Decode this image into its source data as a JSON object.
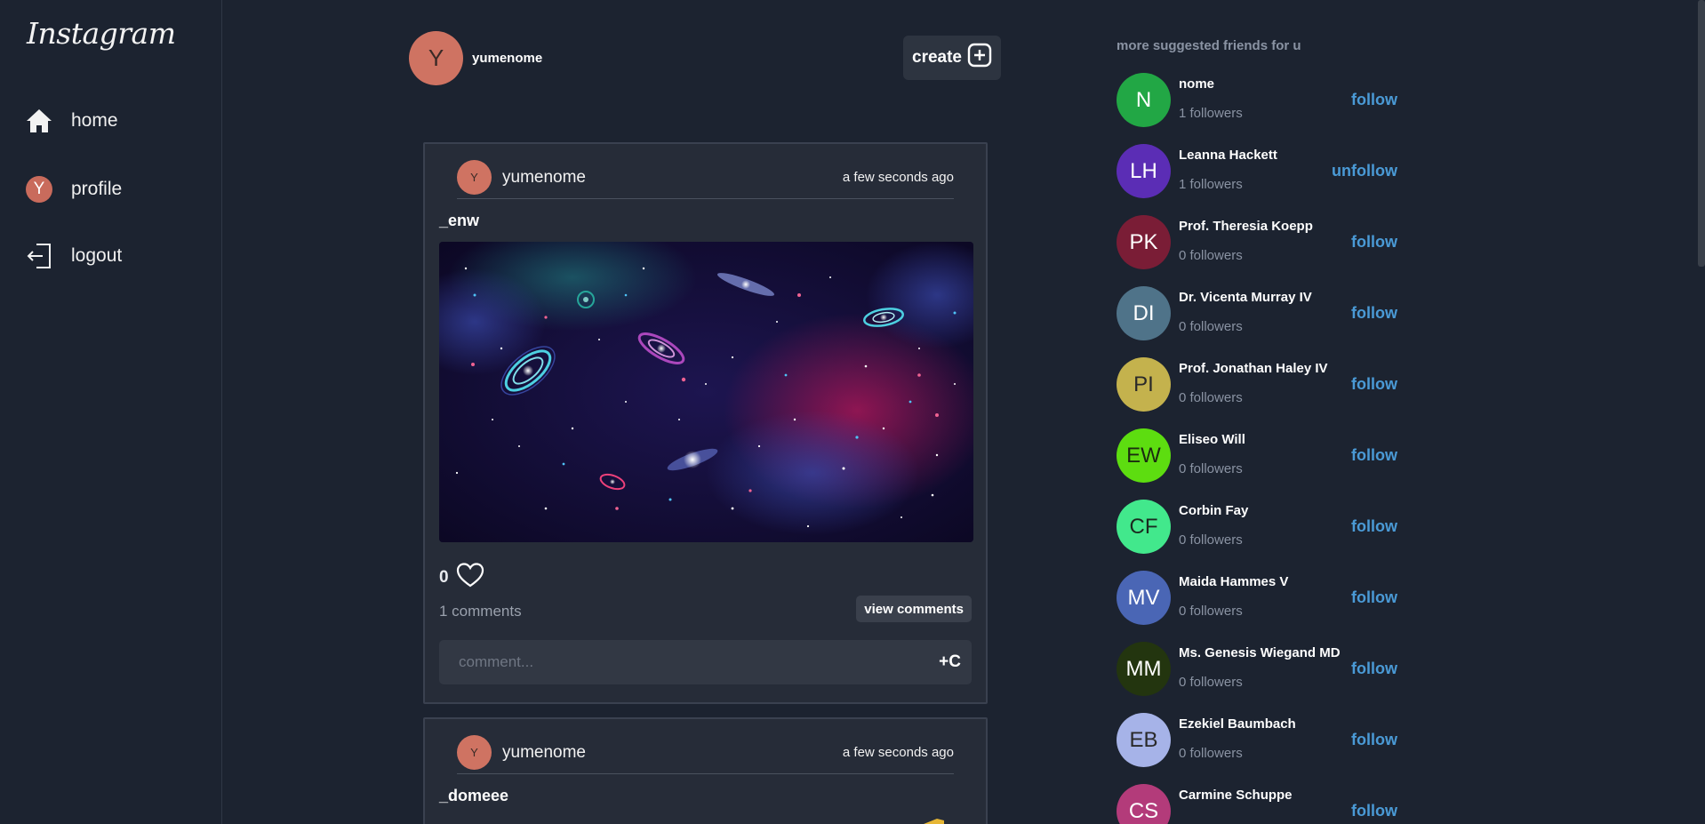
{
  "app": {
    "logo": "Instagram"
  },
  "sidebar": {
    "items": [
      {
        "label": "home",
        "icon": "home-icon"
      },
      {
        "label": "profile",
        "icon": "avatar",
        "initial": "Y"
      },
      {
        "label": "logout",
        "icon": "logout-icon"
      }
    ]
  },
  "current_user": {
    "name": "yumenome",
    "initial": "Y",
    "color": "#cf7362"
  },
  "create_button": {
    "label": "create"
  },
  "posts": [
    {
      "user": "yumenome",
      "initial": "Y",
      "time": "a few seconds ago",
      "caption": "_enw",
      "likes": "0",
      "comments": "1 comments",
      "view_comments": "view comments",
      "comment_placeholder": "comment...",
      "submit": "+C"
    },
    {
      "user": "yumenome",
      "initial": "Y",
      "time": "a few seconds ago",
      "caption": "_domeee"
    }
  ],
  "suggestions": {
    "title": "more suggested friends for u",
    "people": [
      {
        "initials": "N",
        "name": "nome",
        "followers": "1 followers",
        "action": "follow",
        "color": "#22a745",
        "text": "#ffffff"
      },
      {
        "initials": "LH",
        "name": "Leanna Hackett",
        "followers": "1 followers",
        "action": "unfollow",
        "color": "#5b2db5",
        "text": "#ffffff"
      },
      {
        "initials": "PK",
        "name": "Prof. Theresia Koepp",
        "followers": "0 followers",
        "action": "follow",
        "color": "#7a1d36",
        "text": "#ffffff"
      },
      {
        "initials": "DI",
        "name": "Dr. Vicenta Murray IV",
        "followers": "0 followers",
        "action": "follow",
        "color": "#4f7389",
        "text": "#ffffff"
      },
      {
        "initials": "PI",
        "name": "Prof. Jonathan Haley IV",
        "followers": "0 followers",
        "action": "follow",
        "color": "#c4b24d",
        "text": "#2a2a2a"
      },
      {
        "initials": "EW",
        "name": "Eliseo Will",
        "followers": "0 followers",
        "action": "follow",
        "color": "#5ddd10",
        "text": "#1b2a10"
      },
      {
        "initials": "CF",
        "name": "Corbin Fay",
        "followers": "0 followers",
        "action": "follow",
        "color": "#42e88c",
        "text": "#1b2a20"
      },
      {
        "initials": "MV",
        "name": "Maida Hammes V",
        "followers": "0 followers",
        "action": "follow",
        "color": "#4a66b5",
        "text": "#ffffff"
      },
      {
        "initials": "MM",
        "name": "Ms. Genesis Wiegand MD",
        "followers": "0 followers",
        "action": "follow",
        "color": "#23350f",
        "text": "#ffffff"
      },
      {
        "initials": "EB",
        "name": "Ezekiel Baumbach",
        "followers": "0 followers",
        "action": "follow",
        "color": "#a6b3e8",
        "text": "#2a2a2a"
      },
      {
        "initials": "CS",
        "name": "Carmine Schuppe",
        "followers": "",
        "action": "follow",
        "color": "#b33b7a",
        "text": "#ffffff"
      }
    ]
  }
}
